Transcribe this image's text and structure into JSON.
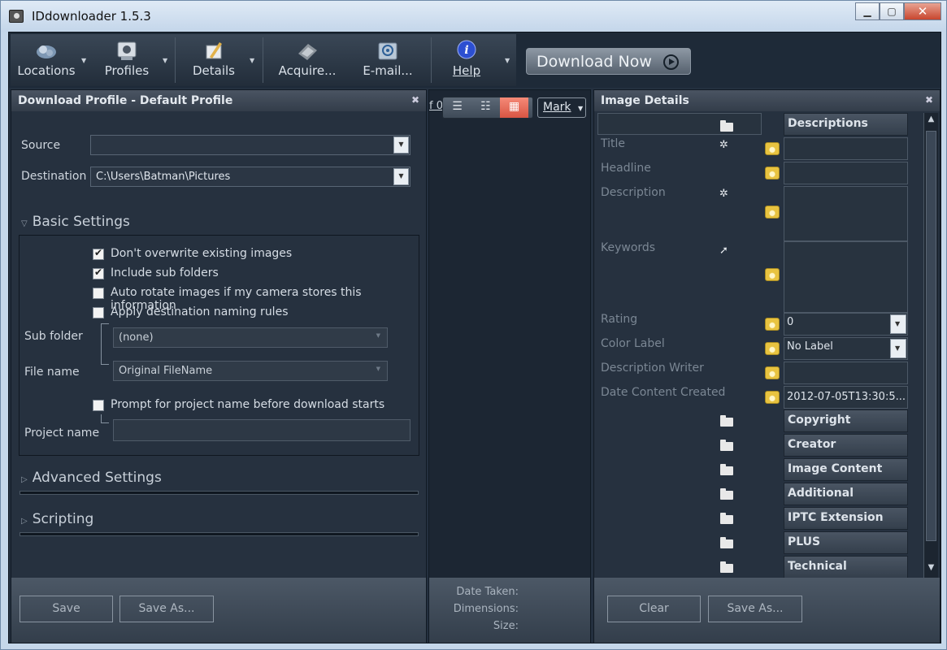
{
  "window": {
    "title": "IDdownloader 1.5.3"
  },
  "toolbar": {
    "items": [
      {
        "label": "Locations",
        "icon": "locations-icon"
      },
      {
        "label": "Profiles",
        "icon": "profiles-icon"
      },
      {
        "label": "Details",
        "icon": "details-icon"
      },
      {
        "label": "Acquire...",
        "icon": "acquire-icon"
      },
      {
        "label": "E-mail...",
        "icon": "email-icon"
      },
      {
        "label": "Help",
        "icon": "help-icon"
      }
    ],
    "download_now": "Download Now"
  },
  "left_panel": {
    "title": "Download Profile - Default Profile",
    "source_label": "Source",
    "source_value": "",
    "destination_label": "Destination",
    "destination_value": "C:\\Users\\Batman\\Pictures",
    "basic_settings": "Basic Settings",
    "options": [
      {
        "label": "Don't overwrite existing images",
        "checked": true
      },
      {
        "label": "Include sub folders",
        "checked": true
      },
      {
        "label": "Auto rotate images if my camera stores this information",
        "checked": false
      },
      {
        "label": "Apply destination naming rules",
        "checked": false
      }
    ],
    "sub_folder_label": "Sub folder",
    "sub_folder_value": "(none)",
    "file_name_label": "File name",
    "file_name_value": "Original FileName",
    "prompt_label": "Prompt for project name before download starts",
    "prompt_checked": false,
    "project_name_label": "Project name",
    "advanced_settings": "Advanced Settings",
    "scripting": "Scripting",
    "save": "Save",
    "save_as": "Save As..."
  },
  "middle_panel": {
    "page_fragment": "f 0",
    "mark": "Mark",
    "date_taken": "Date Taken:",
    "dimensions": "Dimensions:",
    "size": "Size:"
  },
  "right_panel": {
    "title": "Image Details",
    "fields": {
      "title": "Title",
      "headline": "Headline",
      "description": "Description",
      "keywords": "Keywords",
      "rating": "Rating",
      "rating_value": "0",
      "color_label": "Color Label",
      "color_label_value": "No Label",
      "description_writer": "Description Writer",
      "date_content_created": "Date Content Created",
      "date_value": "2012-07-05T13:30:5..."
    },
    "tabs": [
      "Descriptions",
      "Copyright",
      "Creator",
      "Image Content",
      "Additional",
      "IPTC Extension",
      "PLUS",
      "Technical"
    ],
    "clear": "Clear",
    "save_as": "Save As..."
  }
}
